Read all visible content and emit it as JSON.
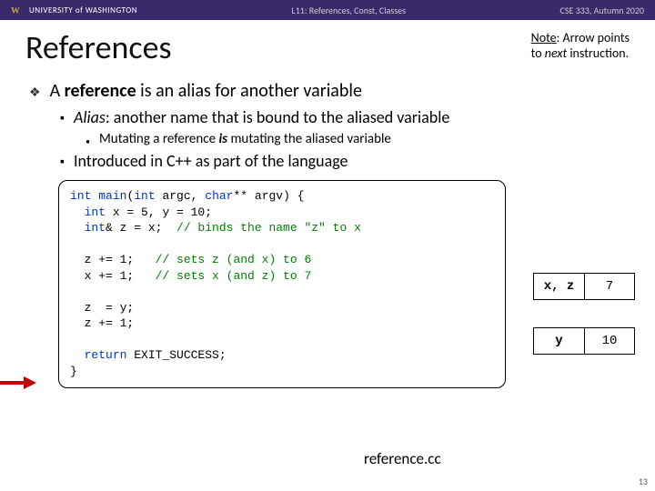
{
  "topbar": {
    "uw_text": "UNIVERSITY of WASHINGTON",
    "center": "L11: References, Const, Classes",
    "right": "CSE 333, Autumn 2020"
  },
  "title": "References",
  "note": {
    "line1_u": "Note",
    "line1_rest": ": Arrow points",
    "line2_pre": "to ",
    "line2_i": "next",
    "line2_post": " instruction."
  },
  "bullets": {
    "l1_pre": "A ",
    "l1_b": "reference",
    "l1_post": " is an alias for another variable",
    "l2a_i": "Alias",
    "l2a_post": ": another name that is bound to the aliased variable",
    "l3_pre": "Mutating a reference ",
    "l3_bi": "is",
    "l3_post": " mutating the aliased variable",
    "l2b": "Introduced in C++ as part of the language"
  },
  "code": {
    "l1_a": "int",
    "l1_b": " ",
    "l1_c": "main",
    "l1_d": "(",
    "l1_e": "int",
    "l1_f": " argc, ",
    "l1_g": "char",
    "l1_h": "** argv) {",
    "l2_a": "  ",
    "l2_b": "int",
    "l2_c": " x = 5, y = 10;",
    "l3_a": "  ",
    "l3_b": "int",
    "l3_c": "& z = x;  ",
    "l3_d": "// binds the name \"z\" to x",
    "l4": "",
    "l5_a": "  z += 1;   ",
    "l5_b": "// sets z (and x) to 6",
    "l6_a": "  x += 1;   ",
    "l6_b": "// sets x (and z) to 7",
    "l7": "",
    "l8": "  z  = y;",
    "l9": "  z += 1;",
    "l10": "",
    "l11_a": "  ",
    "l11_b": "return",
    "l11_c": " EXIT_SUCCESS;",
    "l12": "}"
  },
  "filename": "reference.cc",
  "mem": {
    "r1_label": "x, z",
    "r1_val": "7",
    "r2_label": "y",
    "r2_val": "10"
  },
  "pagenum": "13"
}
